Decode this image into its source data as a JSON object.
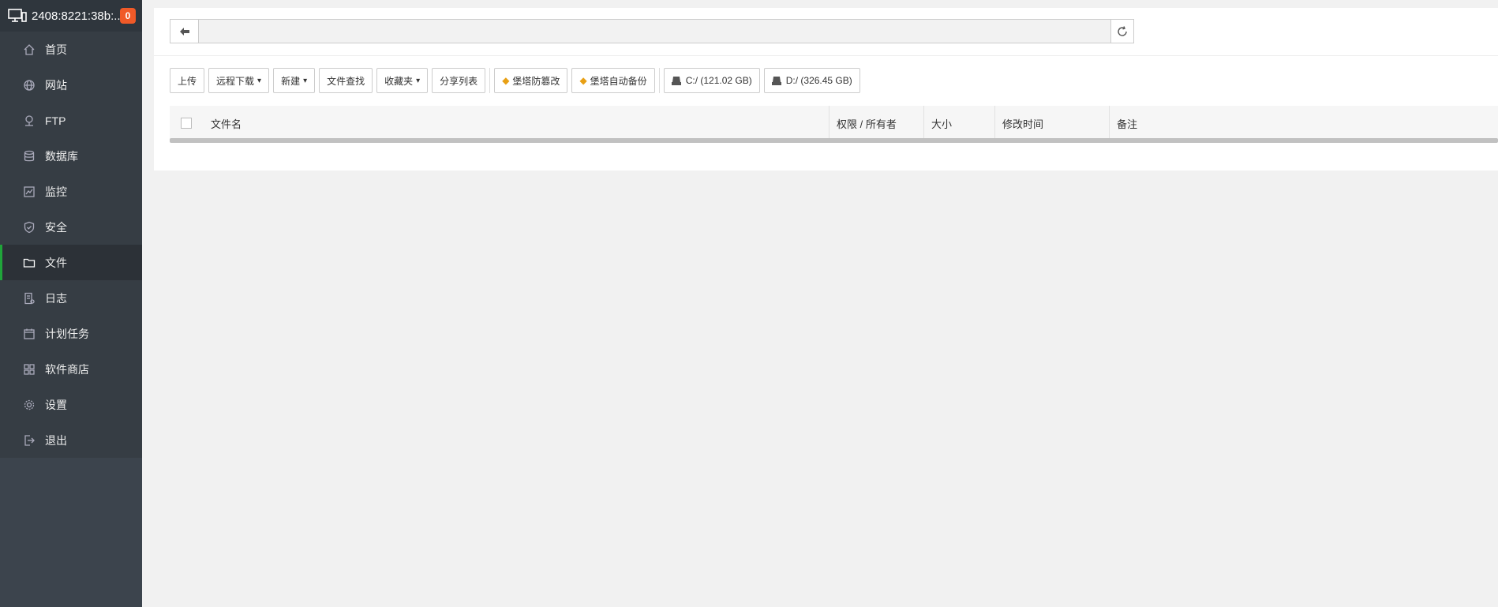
{
  "header": {
    "host": "2408:8221:38b:...",
    "badge": "0"
  },
  "nav": [
    {
      "key": "home",
      "label": "首页",
      "icon": "home-icon"
    },
    {
      "key": "site",
      "label": "网站",
      "icon": "globe-icon"
    },
    {
      "key": "ftp",
      "label": "FTP",
      "icon": "ftp-icon"
    },
    {
      "key": "database",
      "label": "数据库",
      "icon": "database-icon"
    },
    {
      "key": "monitor",
      "label": "监控",
      "icon": "monitor-icon"
    },
    {
      "key": "security",
      "label": "安全",
      "icon": "shield-icon"
    },
    {
      "key": "files",
      "label": "文件",
      "icon": "folder-icon",
      "active": true
    },
    {
      "key": "logs",
      "label": "日志",
      "icon": "log-icon"
    },
    {
      "key": "crontab",
      "label": "计划任务",
      "icon": "calendar-icon"
    },
    {
      "key": "store",
      "label": "软件商店",
      "icon": "grid-icon"
    },
    {
      "key": "settings",
      "label": "设置",
      "icon": "gear-icon"
    },
    {
      "key": "logout",
      "label": "退出",
      "icon": "logout-icon"
    }
  ],
  "pathbar": {
    "path": ""
  },
  "toolbar": {
    "upload": "上传",
    "remote_download": "远程下载",
    "new": "新建",
    "file_search": "文件查找",
    "favorites": "收藏夹",
    "share_list": "分享列表",
    "tamper_proof": "堡塔防篡改",
    "auto_backup": "堡塔自动备份",
    "disk_c": "C:/ (121.02 GB)",
    "disk_d": "D:/ (326.45 GB)"
  },
  "table": {
    "headers": {
      "name": "文件名",
      "perm": "权限 / 所有者",
      "size": "大小",
      "mtime": "修改时间",
      "note": "备注"
    }
  },
  "colors": {
    "accent": "#20a53a",
    "badge": "#f05a28",
    "sidebar": "#3c444d",
    "gem": "#e8a015"
  }
}
